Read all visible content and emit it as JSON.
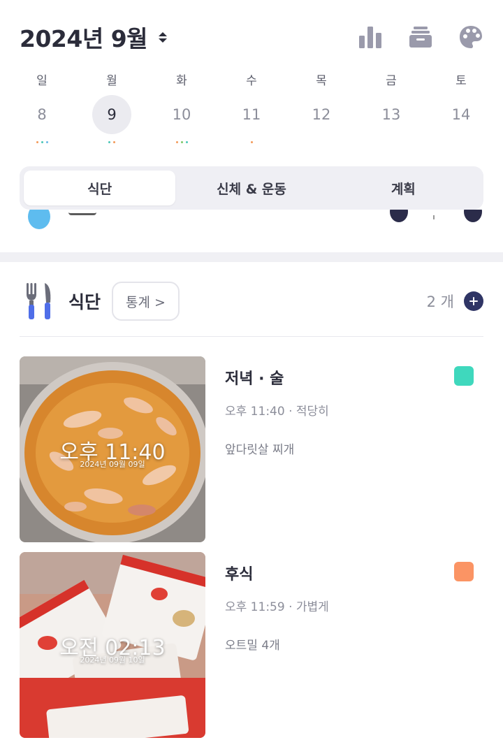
{
  "header": {
    "title": "2024년 9월"
  },
  "week": [
    {
      "name": "일",
      "num": "8",
      "selected": false,
      "dots": [
        "#f39a5a",
        "#4cc7b8",
        "#6bb8e8"
      ]
    },
    {
      "name": "월",
      "num": "9",
      "selected": true,
      "dots": [
        "#4cc7b8",
        "#f39a5a"
      ]
    },
    {
      "name": "화",
      "num": "10",
      "selected": false,
      "dots": [
        "#f39a5a",
        "#7cc96b",
        "#4cc7b8"
      ]
    },
    {
      "name": "수",
      "num": "11",
      "selected": false,
      "dots": [
        "#f39a5a"
      ]
    },
    {
      "name": "목",
      "num": "12",
      "selected": false,
      "dots": []
    },
    {
      "name": "금",
      "num": "13",
      "selected": false,
      "dots": []
    },
    {
      "name": "토",
      "num": "14",
      "selected": false,
      "dots": []
    }
  ],
  "tabs": [
    "식단",
    "신체 & 운동",
    "계획"
  ],
  "meal_section": {
    "title": "식단",
    "stats_label": "통계 >",
    "count": "2 개"
  },
  "meals": [
    {
      "type": "저녁 · 술",
      "meta": "오후 11:40 · 적당히",
      "desc": "앞다릿살 찌개",
      "photo_time": "오후 11:40",
      "photo_date": "2024년 09월 09일",
      "tag_color": "#3fd8bd"
    },
    {
      "type": "후식",
      "meta": "오후 11:59 · 가볍게",
      "desc": "오트밀 4개",
      "photo_time": "오전 02:13",
      "photo_date": "2024년 09월 10일",
      "tag_color": "#fb9464"
    }
  ]
}
